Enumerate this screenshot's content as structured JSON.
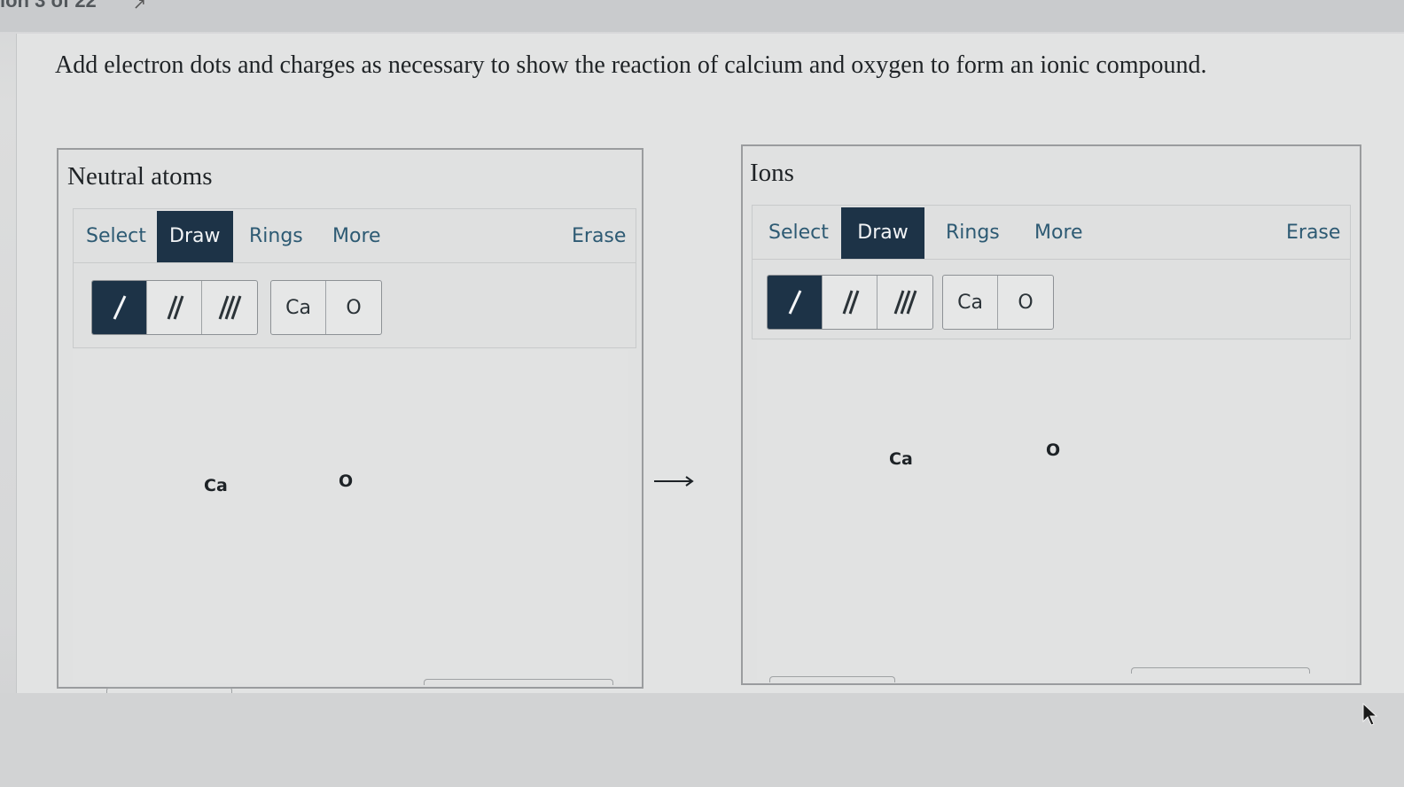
{
  "header": {
    "counter": "ion 3 of 22"
  },
  "prompt": "Add electron dots and charges as necessary to show the reaction of calcium and oxygen to form an ionic compound.",
  "panels": [
    {
      "title": "Neutral atoms",
      "tabs": [
        "Select",
        "Draw",
        "Rings",
        "More"
      ],
      "active_tab": "Draw",
      "erase_label": "Erase",
      "bond_tools": [
        "single-bond",
        "double-bond",
        "triple-bond"
      ],
      "active_bond": "single-bond",
      "element_buttons": [
        "Ca",
        "O"
      ],
      "atoms": [
        "Ca",
        "O"
      ]
    },
    {
      "title": "Ions",
      "tabs": [
        "Select",
        "Draw",
        "Rings",
        "More"
      ],
      "active_tab": "Draw",
      "erase_label": "Erase",
      "bond_tools": [
        "single-bond",
        "double-bond",
        "triple-bond"
      ],
      "active_bond": "single-bond",
      "element_buttons": [
        "Ca",
        "O"
      ],
      "atoms": [
        "Ca",
        "O"
      ]
    }
  ],
  "reaction_arrow": "right-arrow-icon",
  "colors": {
    "accent_active": "#1d3347",
    "tab_text": "#2d5a73",
    "panel_border": "#9a9c9e"
  }
}
